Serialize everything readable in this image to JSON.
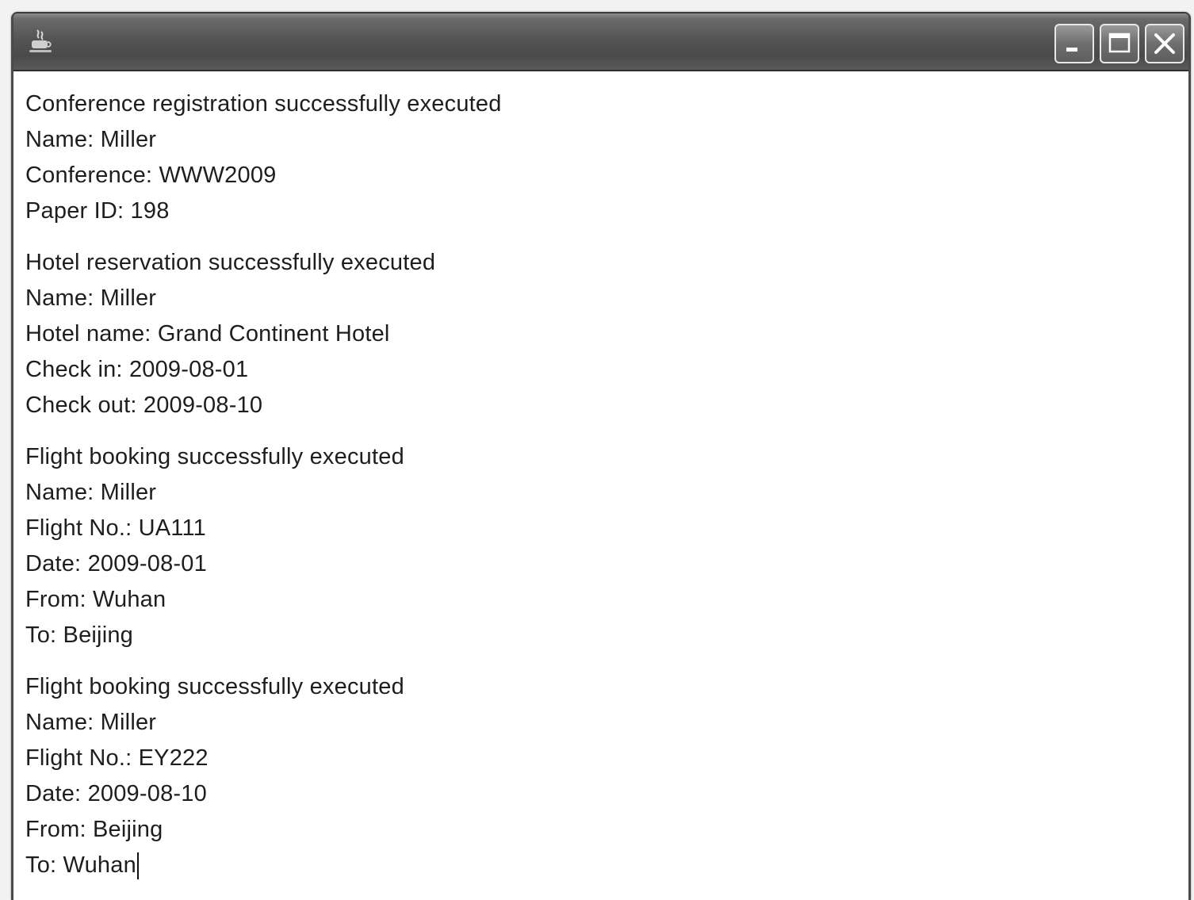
{
  "window": {
    "title": "",
    "app_icon": "java-coffee-cup-icon",
    "controls": {
      "minimize_icon": "minimize-icon",
      "maximize_icon": "maximize-icon",
      "close_icon": "close-icon"
    }
  },
  "output": {
    "blocks": [
      {
        "lines": [
          "Conference registration successfully executed",
          "Name: Miller",
          "Conference: WWW2009",
          "Paper ID: 198"
        ]
      },
      {
        "lines": [
          "Hotel reservation successfully executed",
          "Name: Miller",
          "Hotel name: Grand Continent Hotel",
          "Check in: 2009-08-01",
          "Check out: 2009-08-10"
        ]
      },
      {
        "lines": [
          "Flight booking successfully executed",
          "Name: Miller",
          "Flight No.: UA111",
          "Date: 2009-08-01",
          "From: Wuhan",
          "To: Beijing"
        ]
      },
      {
        "lines": [
          "Flight booking successfully executed",
          "Name: Miller",
          "Flight No.: EY222",
          "Date: 2009-08-10",
          "From: Beijing",
          "To: Wuhan"
        ]
      }
    ]
  }
}
